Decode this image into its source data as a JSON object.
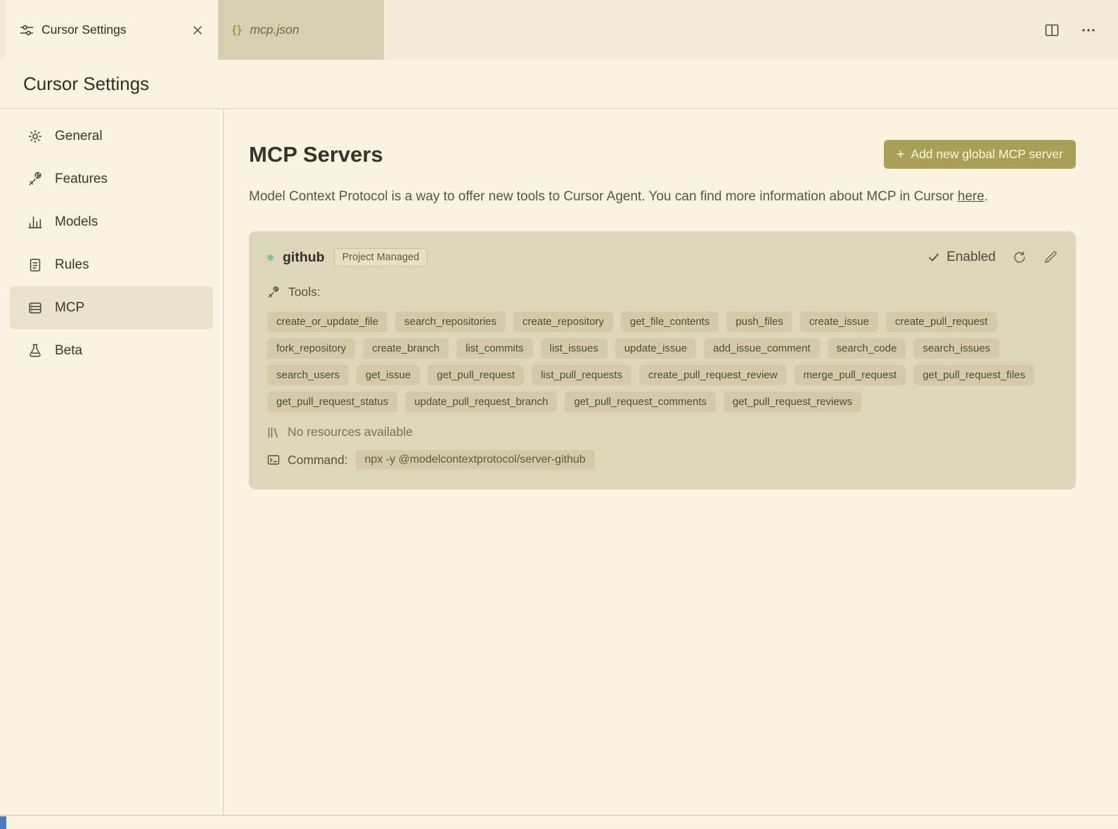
{
  "colors": {
    "page_bg": "#f9f3e0",
    "card_bg": "#ded6ba",
    "tag_bg": "#d3caa9",
    "button_bg": "#a8a055",
    "status_green": "#84c79d"
  },
  "tab_bar": {
    "settings_tab_label": "Cursor Settings",
    "json_tab_braces": "{}",
    "json_tab_label": "mcp.json"
  },
  "page_title": "Cursor Settings",
  "sidebar": {
    "items": [
      {
        "label": "General"
      },
      {
        "label": "Features"
      },
      {
        "label": "Models"
      },
      {
        "label": "Rules"
      },
      {
        "label": "MCP"
      },
      {
        "label": "Beta"
      }
    ]
  },
  "main": {
    "title": "MCP Servers",
    "add_button": {
      "plus": "+",
      "label": "Add new global MCP server"
    },
    "description_prefix": "Model Context Protocol is a way to offer new tools to Cursor Agent. You can find more information about MCP in Cursor ",
    "description_link": "here",
    "description_suffix": ".",
    "server": {
      "name": "github",
      "badge": "Project Managed",
      "status_label": "Enabled",
      "tools_label": "Tools:",
      "tools": [
        "create_or_update_file",
        "search_repositories",
        "create_repository",
        "get_file_contents",
        "push_files",
        "create_issue",
        "create_pull_request",
        "fork_repository",
        "create_branch",
        "list_commits",
        "list_issues",
        "update_issue",
        "add_issue_comment",
        "search_code",
        "search_issues",
        "search_users",
        "get_issue",
        "get_pull_request",
        "list_pull_requests",
        "create_pull_request_review",
        "merge_pull_request",
        "get_pull_request_files",
        "get_pull_request_status",
        "update_pull_request_branch",
        "get_pull_request_comments",
        "get_pull_request_reviews"
      ],
      "resources_text": "No resources available",
      "command_label": "Command:",
      "command_value": "npx -y @modelcontextprotocol/server-github"
    }
  }
}
